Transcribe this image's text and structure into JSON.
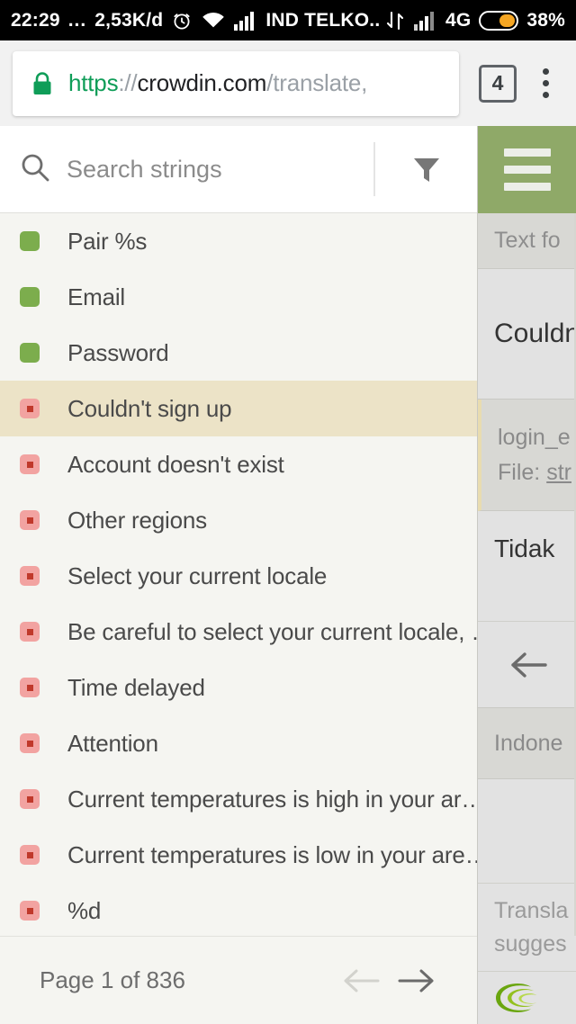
{
  "status_bar": {
    "time": "22:29",
    "overflow_dots": "...",
    "data_rate": "2,53K/d",
    "alarm_icon": "alarm-clock-icon",
    "wifi_icon": "wifi-icon",
    "signal_icon": "signal-bars-icon",
    "carrier": "IND TELKO..",
    "data_transfer_icon": "data-transfer-icon",
    "signal2_icon": "signal-bars-icon",
    "network_type": "4G",
    "battery_icon": "battery-icon",
    "battery_percent": "38%",
    "battery_level": 38,
    "background_color": "#000000"
  },
  "browser": {
    "lock_icon": "lock-icon",
    "url": {
      "scheme": "https",
      "separator": "://",
      "host": "crowdin.com",
      "path": "/translate,"
    },
    "tab_count": "4",
    "menu_icon": "kebab-menu-icon"
  },
  "search": {
    "icon": "search-icon",
    "placeholder": "Search strings",
    "value": "",
    "filter_icon": "filter-funnel-icon"
  },
  "menu": {
    "hamburger_icon": "hamburger-menu-icon",
    "background_color": "#8fa968"
  },
  "strings_list": {
    "selected_index": 3,
    "items": [
      {
        "label": "Pair %s",
        "status": "done"
      },
      {
        "label": "Email",
        "status": "done"
      },
      {
        "label": "Password",
        "status": "done"
      },
      {
        "label": "Couldn't sign up",
        "status": "todo"
      },
      {
        "label": "Account doesn't exist",
        "status": "todo"
      },
      {
        "label": "Other regions",
        "status": "todo"
      },
      {
        "label": "Select your current locale",
        "status": "todo"
      },
      {
        "label": "Be careful to select your current locale, …",
        "status": "todo"
      },
      {
        "label": "Time delayed",
        "status": "todo"
      },
      {
        "label": "Attention",
        "status": "todo"
      },
      {
        "label": "Current temperatures is high in your ar…",
        "status": "todo"
      },
      {
        "label": "Current temperatures is low in your are…",
        "status": "todo"
      },
      {
        "label": "%d",
        "status": "todo"
      }
    ],
    "colors": {
      "translated": "#7cad4d",
      "untranslated": "#f2a3a1",
      "untranslated_dot": "#c0392b",
      "selected_row": "#ece3c7",
      "list_background": "#f5f5f1"
    }
  },
  "pagination": {
    "label": "Page 1 of 836",
    "current_page": 1,
    "total_pages": 836,
    "prev_icon": "arrow-left-icon",
    "prev_enabled": false,
    "next_icon": "arrow-right-icon",
    "next_enabled": true
  },
  "editor_panel": {
    "section_header": "Text fo",
    "source_string": "Couldn",
    "string_key": "login_e",
    "file_prefix": "File: ",
    "file_name": "str",
    "translation": "Tidak ",
    "back_icon": "arrow-left-icon",
    "language": "Indone",
    "tm_line1": "Transla",
    "tm_line2": "sugges",
    "logo_icon": "crowdin-logo-icon"
  }
}
